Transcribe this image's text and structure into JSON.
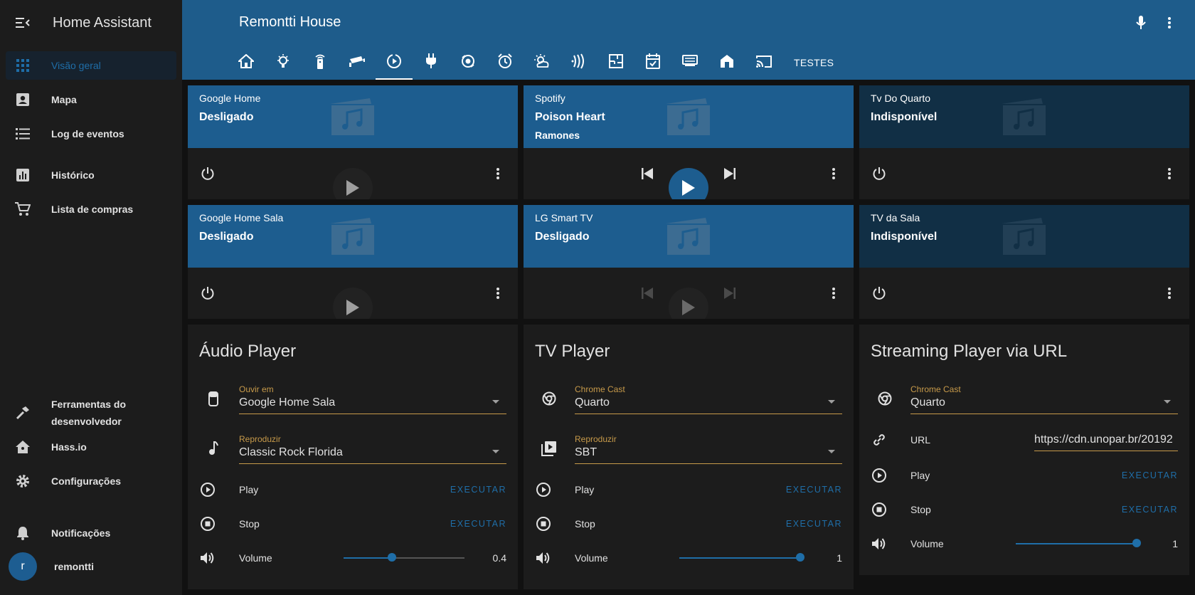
{
  "app": {
    "title": "Home Assistant"
  },
  "sidebar": {
    "items": [
      {
        "label": "Visão geral",
        "icon": "apps-icon"
      },
      {
        "label": "Mapa",
        "icon": "account-box-icon"
      },
      {
        "label": "Log de eventos",
        "icon": "list-icon"
      },
      {
        "label": "Histórico",
        "icon": "chart-bar-icon"
      },
      {
        "label": "Lista de compras",
        "icon": "cart-icon"
      }
    ],
    "bottom": [
      {
        "label": "Ferramentas do desenvolvedor",
        "icon": "hammer-icon"
      },
      {
        "label": "Hass.io",
        "icon": "home-assistant-icon"
      },
      {
        "label": "Configurações",
        "icon": "gear-icon"
      },
      {
        "label": "Notificações",
        "icon": "bell-icon"
      }
    ],
    "user": {
      "initial": "r",
      "name": "remontti"
    }
  },
  "header": {
    "title": "Remontti House",
    "tabs_text": "TESTES",
    "accent": "#1e5c8b"
  },
  "media": [
    {
      "name": "Google Home",
      "state": "Desligado",
      "artist": ""
    },
    {
      "name": "Spotify",
      "state": "Poison Heart",
      "artist": "Ramones"
    },
    {
      "name": "Tv Do Quarto",
      "state": "Indisponível",
      "artist": ""
    },
    {
      "name": "Google Home Sala",
      "state": "Desligado",
      "artist": ""
    },
    {
      "name": "LG Smart TV",
      "state": "Desligado",
      "artist": ""
    },
    {
      "name": "TV da Sala",
      "state": "Indisponível",
      "artist": ""
    }
  ],
  "audio": {
    "title": "Áudio Player",
    "select1": {
      "label": "Ouvir em",
      "value": "Google Home Sala"
    },
    "select2": {
      "label": "Reproduzir",
      "value": "Classic Rock Florida"
    },
    "play": "Play",
    "stop": "Stop",
    "exec": "EXECUTAR",
    "volume_label": "Volume",
    "volume": "0.4",
    "volume_fraction": 0.4
  },
  "tv": {
    "title": "TV Player",
    "select1": {
      "label": "Chrome Cast",
      "value": "Quarto"
    },
    "select2": {
      "label": "Reproduzir",
      "value": "SBT"
    },
    "play": "Play",
    "stop": "Stop",
    "exec": "EXECUTAR",
    "volume_label": "Volume",
    "volume": "1",
    "volume_fraction": 1
  },
  "stream": {
    "title": "Streaming Player via URL",
    "select1": {
      "label": "Chrome Cast",
      "value": "Quarto"
    },
    "url_label": "URL",
    "url_value": "https://cdn.unopar.br/20192",
    "play": "Play",
    "stop": "Stop",
    "exec": "EXECUTAR",
    "volume_label": "Volume",
    "volume": "1",
    "volume_fraction": 1
  }
}
